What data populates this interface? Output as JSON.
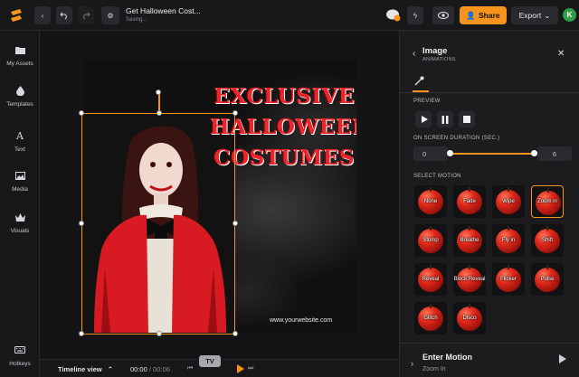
{
  "header": {
    "title": "Get Halloween Cost...",
    "subtitle": "Saving...",
    "share_label": "Share",
    "export_label": "Export",
    "avatar_initial": "K"
  },
  "sidebar": {
    "items": [
      {
        "label": "My Assets",
        "icon": "folder-icon"
      },
      {
        "label": "Templates",
        "icon": "drop-icon"
      },
      {
        "label": "Text",
        "icon": "text-icon"
      },
      {
        "label": "Media",
        "icon": "image-icon"
      },
      {
        "label": "Visuals",
        "icon": "crown-icon"
      }
    ],
    "hotkeys_label": "Hotkeys"
  },
  "poster": {
    "headline_lines": [
      "EXCLUSIVE",
      "HALLOWEEN",
      "COSTUMES"
    ],
    "website": "www.yourwebsite.com"
  },
  "panel": {
    "title": "Image",
    "subtitle": "ANIMATIONS",
    "preview_label": "PREVIEW",
    "duration_label": "ON SCREEN DURATION (SEC.)",
    "duration_min": "0",
    "duration_max": "6",
    "duration_start": 0,
    "duration_end": 6,
    "select_motion_label": "SELECT MOTION",
    "motions": [
      "None",
      "Fade",
      "Wipe",
      "Zoom in",
      "Stomp",
      "Breathe",
      "Fly in",
      "Shift",
      "Reveal",
      "Block Reveal",
      "Flicker",
      "Pulse",
      "Glitch",
      "Disco"
    ],
    "selected_motion": "Zoom in",
    "enter_title": "Enter Motion",
    "enter_value": "Zoom In"
  },
  "timeline": {
    "label": "Timeline view",
    "current": "00:00",
    "total": "/ 00:06",
    "badge": "TV"
  },
  "colors": {
    "accent": "#f7941d",
    "headline_red": "#e8262b",
    "panel_bg": "#1c1c1f"
  }
}
